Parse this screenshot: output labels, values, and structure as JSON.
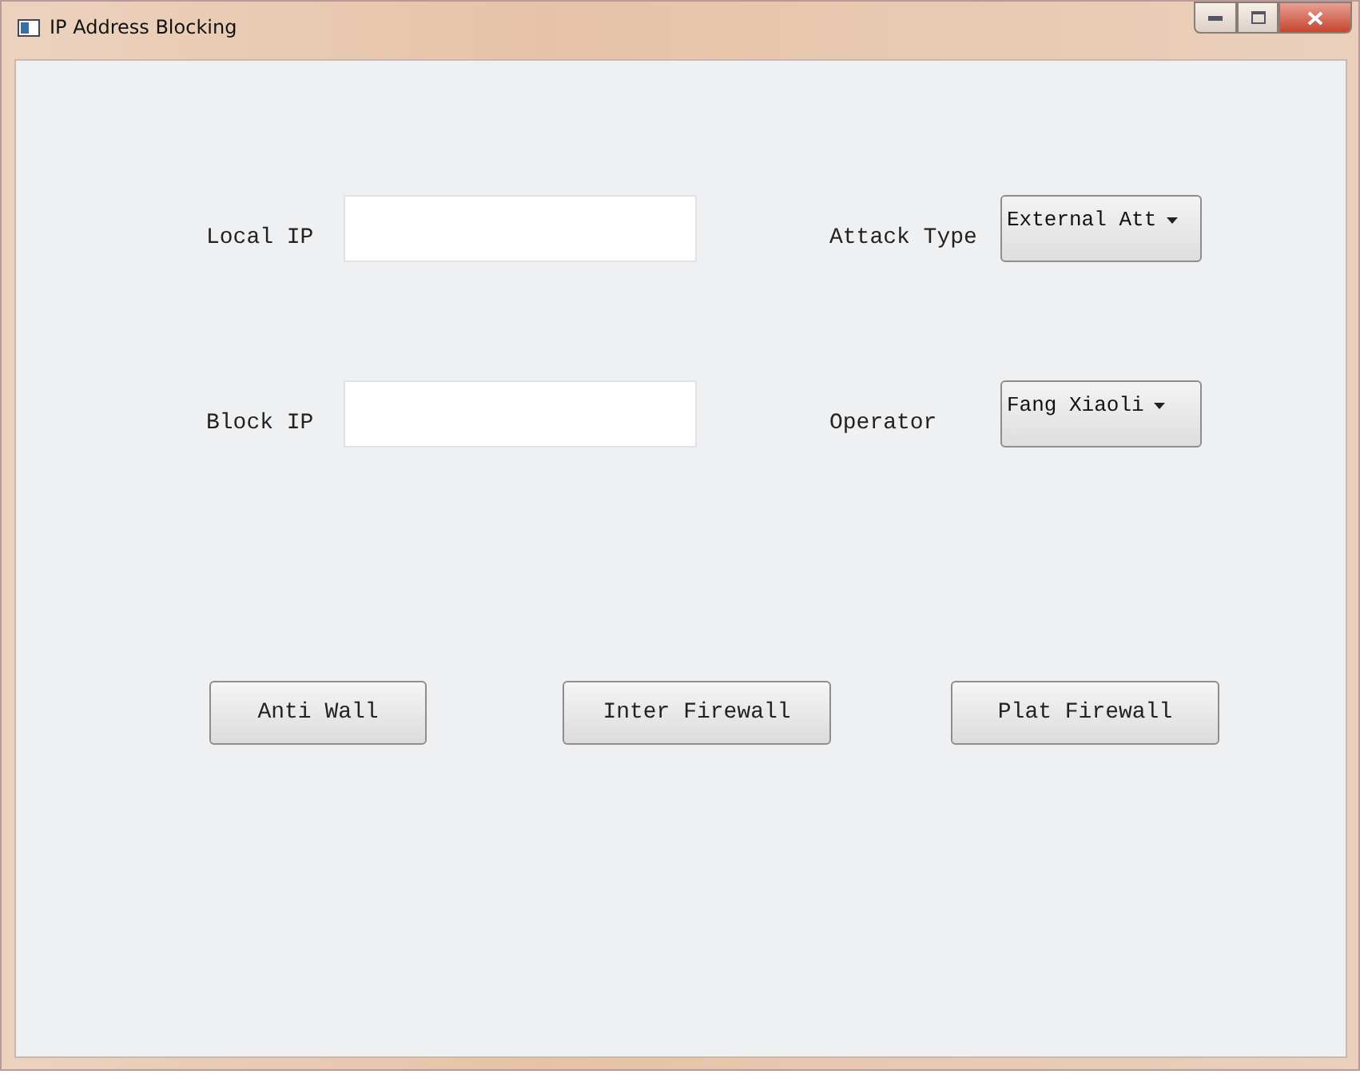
{
  "window": {
    "title": "IP Address Blocking"
  },
  "rows": [
    {
      "left": {
        "label": "Local IP",
        "kind": "input"
      },
      "right": {
        "label": "Attack Type",
        "kind": "combo",
        "value": "External Att"
      }
    },
    {
      "left": {
        "label": "Block IP",
        "kind": "input"
      },
      "right": {
        "label": "Operator",
        "kind": "combo",
        "value": "Fang Xiaoli"
      }
    }
  ],
  "buttons": [
    "Anti Wall",
    "Inter Firewall",
    "Plat Firewall"
  ]
}
